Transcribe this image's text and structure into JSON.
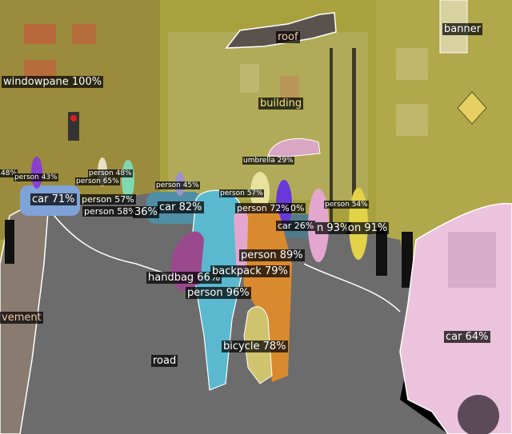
{
  "colors": {
    "sky_building": "#a8a13e",
    "road": "#6c6c6c",
    "pavement": "#8a7b70",
    "roof": "#5a534d",
    "car_pink": "#ecc3dc",
    "car_blue": "#7fa2d8",
    "person_cyan": "#5ab9cf",
    "person_orange": "#d98a2e",
    "person_pink": "#e3a7cf",
    "handbag": "#9a4a8c",
    "bicycle": "#cfc36d",
    "umbrella": "#d9a6c4",
    "mask_outline": "#ffffff"
  },
  "detections": [
    {
      "label": "roof",
      "style": "warm"
    },
    {
      "label": "banner",
      "style": ""
    },
    {
      "label": "windowpane 100%",
      "style": ""
    },
    {
      "label": "building",
      "style": "gold"
    },
    {
      "label": "umbrella 29%",
      "style": "sm"
    },
    {
      "label": "48%",
      "style": "sm"
    },
    {
      "label": "person 43%",
      "style": "sm"
    },
    {
      "label": "person 48%",
      "style": "sm"
    },
    {
      "label": "person 65%",
      "style": "sm"
    },
    {
      "label": "person 45%",
      "style": "sm"
    },
    {
      "label": "car 71%",
      "style": ""
    },
    {
      "label": "person 57%",
      "style": "sm"
    },
    {
      "label": "person 57%",
      "style": "md"
    },
    {
      "label": "person 58%",
      "style": "md"
    },
    {
      "label": "36%",
      "style": ""
    },
    {
      "label": "car 82%",
      "style": ""
    },
    {
      "label": "person 72%",
      "style": "md"
    },
    {
      "label": "0%",
      "style": "md"
    },
    {
      "label": "person 54%",
      "style": "sm"
    },
    {
      "label": "car 26%",
      "style": "md"
    },
    {
      "label": "n 93%",
      "style": ""
    },
    {
      "label": "on 91%",
      "style": ""
    },
    {
      "label": "person 89%",
      "style": ""
    },
    {
      "label": "handbag 66%",
      "style": ""
    },
    {
      "label": "backpack 79%",
      "style": ""
    },
    {
      "label": "person 96%",
      "style": ""
    },
    {
      "label": "vement",
      "style": "warm"
    },
    {
      "label": "car 64%",
      "style": ""
    },
    {
      "label": "road",
      "style": ""
    },
    {
      "label": "bicycle 78%",
      "style": ""
    }
  ]
}
